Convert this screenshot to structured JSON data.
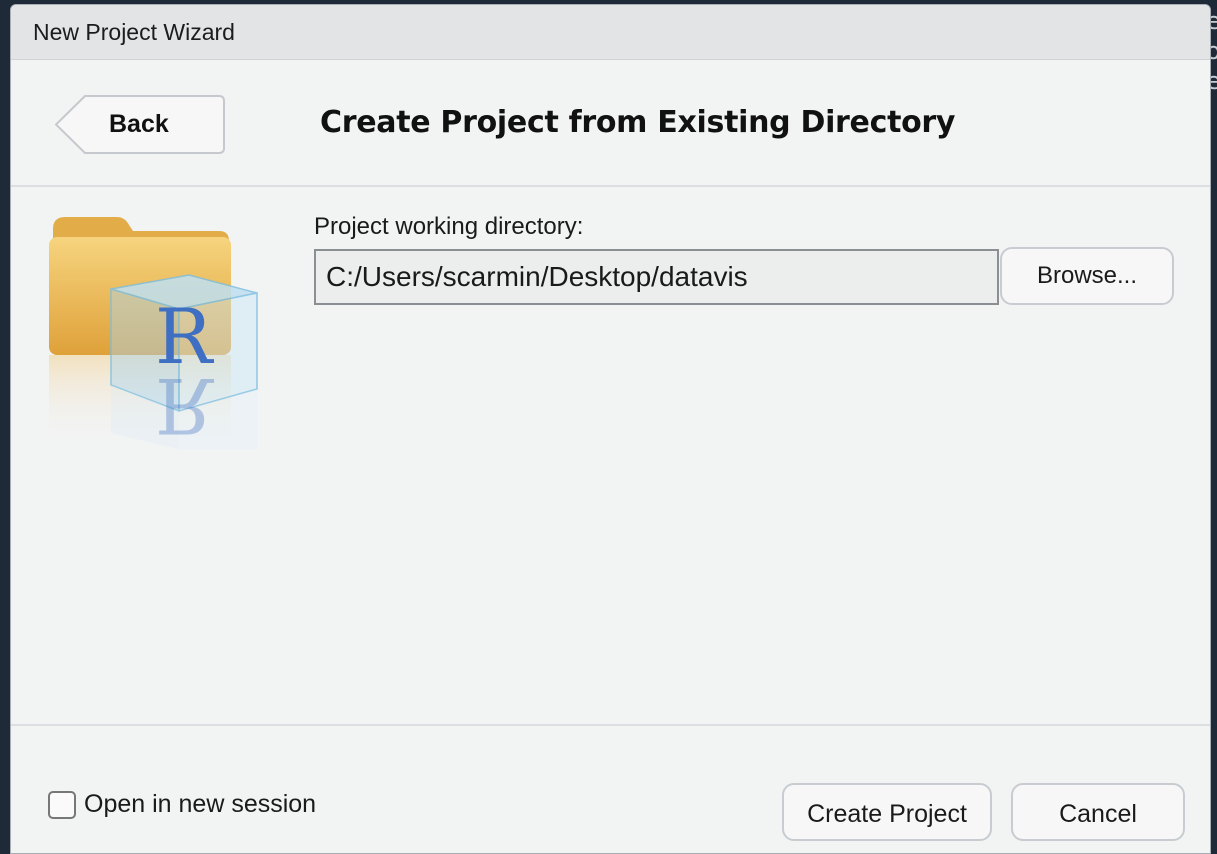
{
  "window": {
    "title": "New Project Wizard"
  },
  "header": {
    "back_label": "Back",
    "title": "Create Project from Existing Directory"
  },
  "form": {
    "directory_label": "Project working directory:",
    "directory_value": "C:/Users/scarmin/Desktop/datavis",
    "browse_label": "Browse..."
  },
  "footer": {
    "new_session_label": "Open in new session",
    "new_session_checked": false,
    "create_label": "Create Project",
    "cancel_label": "Cancel"
  },
  "icons": {
    "project": "r-project-folder-icon",
    "r_letter": "R"
  },
  "colors": {
    "dialog_bg": "#f2f3f3",
    "titlebar_bg": "#e3e4e6",
    "folder": "#e8b44a",
    "r_blue": "#3f6fc2"
  }
}
